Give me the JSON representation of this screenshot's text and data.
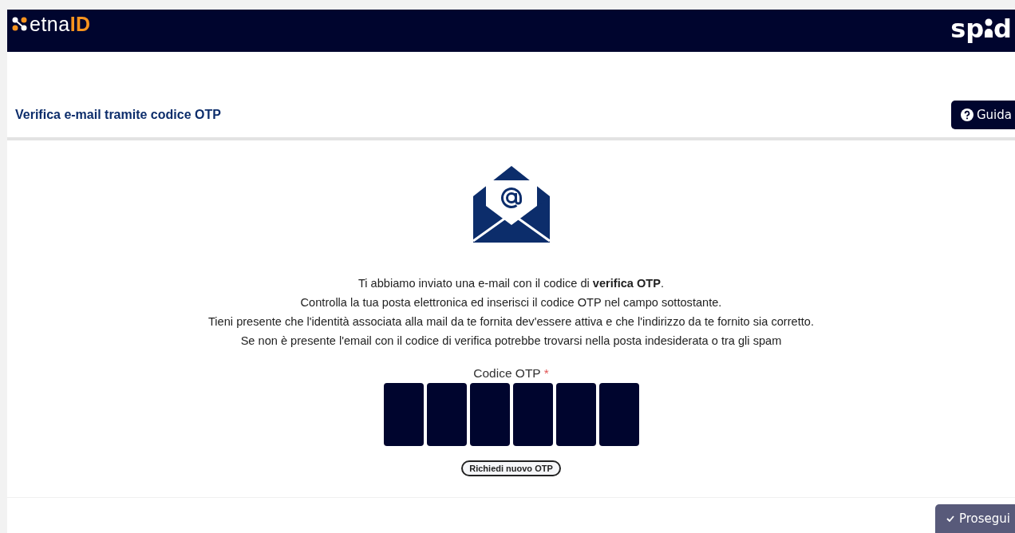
{
  "header": {
    "logo": {
      "text": "etna",
      "accent": "ID"
    },
    "spid_logo": {
      "left": "sp",
      "right": "d"
    }
  },
  "page_title": "Verifica e-mail tramite codice OTP",
  "help_button": {
    "label": "Guida"
  },
  "message_lines": [
    "Ti abbiamo inviato una e-mail con il codice di **verifica OTP**.",
    "Controlla la tua posta elettronica ed inserisci il codice OTP nel campo sottostante.",
    "Tieni presente che l'identità associata alla mail da te fornita dev'essere attiva e che l'indirizzo da te fornito sia corretto.",
    "Se non è presente l'email con il codice di verifica potrebbe trovarsi nella posta indesiderata o tra gli spam"
  ],
  "otp": {
    "label": "Codice OTP",
    "required_mark": "*",
    "digit_fields": [
      {
        "filled": false
      },
      {
        "filled": false
      },
      {
        "filled": false
      },
      {
        "filled": false
      },
      {
        "filled": false
      },
      {
        "filled": false
      }
    ]
  },
  "resend_button": {
    "label": "Richiedi nuovo OTP"
  },
  "continue_button": {
    "label": "Prosegui"
  }
}
